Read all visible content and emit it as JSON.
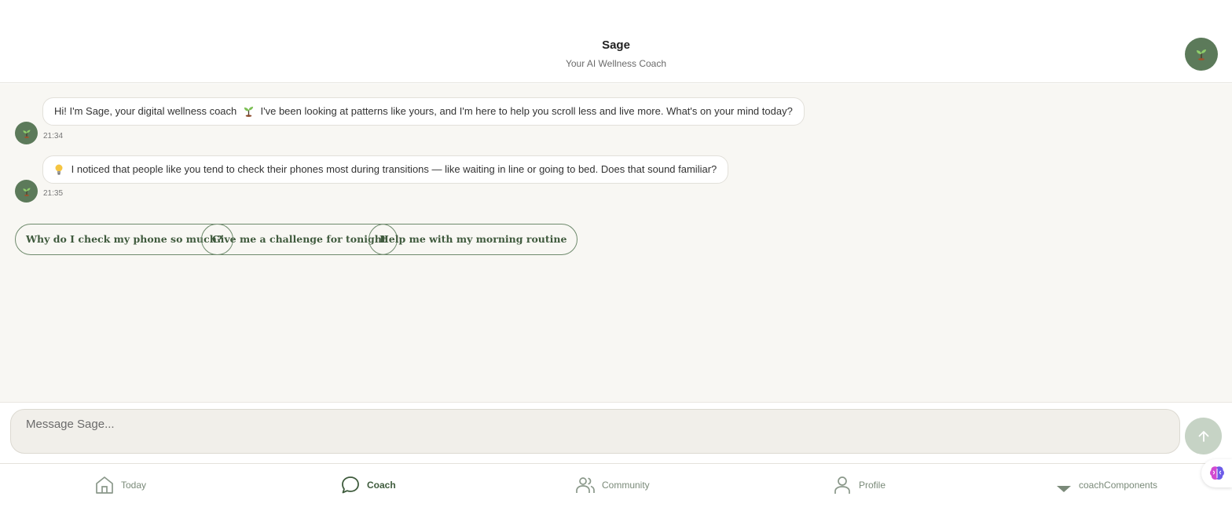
{
  "header": {
    "title": "Sage",
    "subtitle": "Your AI Wellness Coach",
    "avatar_icon": "seedling-icon"
  },
  "messages": [
    {
      "emoji_icon": "seedling-icon",
      "text_before": "Hi! I'm Sage, your digital wellness coach",
      "text_after": "I've been looking at patterns like yours, and I'm here to help you scroll less and live more. What's on your mind today?",
      "time": "21:34"
    },
    {
      "emoji_icon": "lightbulb-icon",
      "text": "I noticed that people like you tend to check their phones most during transitions — like waiting in line or going to bed. Does that sound familiar?",
      "time": "21:35"
    }
  ],
  "suggestions": [
    "Why do I check my phone so much?",
    "Give me a challenge for tonight",
    "Help me with my morning routine"
  ],
  "composer": {
    "placeholder": "Message Sage...",
    "send_icon": "arrow-up-icon"
  },
  "nav": {
    "items": [
      {
        "label": "Today",
        "icon": "home-icon",
        "active": false
      },
      {
        "label": "Coach",
        "icon": "chat-bubble-icon",
        "active": true
      },
      {
        "label": "Community",
        "icon": "users-icon",
        "active": false
      },
      {
        "label": "Profile",
        "icon": "user-icon",
        "active": false
      },
      {
        "label": "coachComponents",
        "icon": "triangle-down-icon",
        "active": false
      }
    ]
  },
  "colors": {
    "accent": "#5c7a5a",
    "chat_background": "#f8f7f3",
    "send_disabled": "#c6d3c5"
  }
}
